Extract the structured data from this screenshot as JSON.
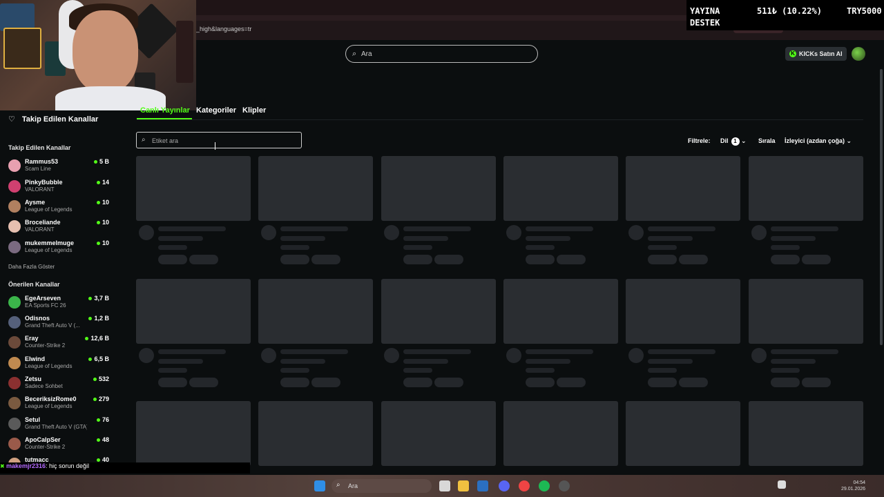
{
  "browser": {
    "url_fragment": "_high&languages=tr"
  },
  "stream_overlay": {
    "line1": "YAYINA",
    "line2": "DESTEK",
    "value": "511₺ (10.22%)",
    "goal": "TRY5000"
  },
  "header": {
    "search_placeholder": "Ara",
    "kicks_label": "KICKs Satın Al"
  },
  "sidebar": {
    "header_label": "Takip Edilen Kanallar",
    "followed_title": "Takip Edilen Kanallar",
    "followed": [
      {
        "name": "Rammus53",
        "game": "Scam Line",
        "viewers": "5 B",
        "color": "#e8a0b0"
      },
      {
        "name": "PinkyBubble",
        "game": "VALORANT",
        "viewers": "14",
        "color": "#d04070"
      },
      {
        "name": "Aysme",
        "game": "League of Legends",
        "viewers": "10",
        "color": "#b08060"
      },
      {
        "name": "Broceliande",
        "game": "VALORANT",
        "viewers": "10",
        "color": "#e6c0b0"
      },
      {
        "name": "mukemmelmuge",
        "game": "League of Legends",
        "viewers": "10",
        "color": "#7a6a80"
      }
    ],
    "show_more": "Daha Fazla Göster",
    "recommended_title": "Önerilen Kanallar",
    "recommended": [
      {
        "name": "EgeArseven",
        "game": "EA Sports FC 26",
        "viewers": "3,7 B",
        "color": "#3bb54a"
      },
      {
        "name": "Odisnos",
        "game": "Grand Theft Auto V (...",
        "viewers": "1,2 B",
        "color": "#55607a"
      },
      {
        "name": "Eray",
        "game": "Counter-Strike 2",
        "viewers": "12,6 B",
        "color": "#6b4a3a"
      },
      {
        "name": "Elwind",
        "game": "League of Legends",
        "viewers": "6,5 B",
        "color": "#c08a50"
      },
      {
        "name": "Zetsu",
        "game": "Sadece Sohbet",
        "viewers": "532",
        "color": "#8a3030"
      },
      {
        "name": "BeceriksizRome0",
        "game": "League of Legends",
        "viewers": "279",
        "color": "#7a5a40"
      },
      {
        "name": "Setul",
        "game": "Grand Theft Auto V (GTA)",
        "viewers": "76",
        "color": "#5a5a5a"
      },
      {
        "name": "ApoCalpSer",
        "game": "Counter-Strike 2",
        "viewers": "48",
        "color": "#9a5a4a"
      },
      {
        "name": "tutmacc",
        "game": "",
        "viewers": "40",
        "color": "#d0a080"
      }
    ]
  },
  "tabs": {
    "live": "Canlı Yayınlar",
    "categories": "Kategoriler",
    "clips": "Klipler"
  },
  "filters": {
    "tag_placeholder": "Etiket ara",
    "filter_label": "Filtrele:",
    "language_label": "Dil",
    "language_count": "1",
    "sort_label": "Sırala",
    "sort_value": "İzleyici (azdan çoğa)"
  },
  "chat": {
    "user": "makemjr2316",
    "message": ": hiç sorun değil"
  },
  "taskbar": {
    "search_placeholder": "Ara",
    "date_line1": "04:54",
    "date_line2": "29.01.2026"
  }
}
